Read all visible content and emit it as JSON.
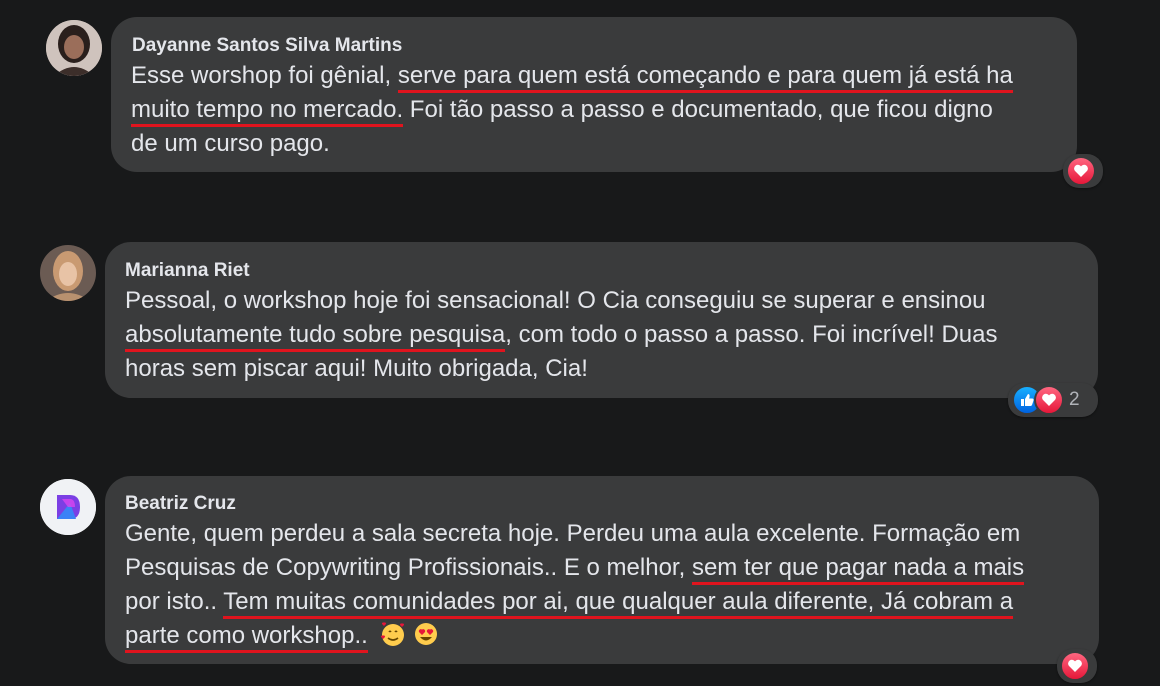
{
  "comments": [
    {
      "author": "Dayanne Santos Silva Martins",
      "avatar_icon": "profile-photo-icon",
      "lines": [
        [
          "Esse worshop foi gênial, ",
          "serve para quem está começando e para quem já está ha"
        ],
        [
          "muito tempo no mercado.",
          " Foi tão passo a passo e documentado, que ficou digno"
        ],
        [
          "de um curso pago."
        ]
      ],
      "reactions": [
        "heart-icon"
      ]
    },
    {
      "author": "Marianna Riet",
      "avatar_icon": "profile-photo-icon",
      "lines": [
        [
          "Pessoal, o workshop hoje foi sensacional! O Cia conseguiu se superar e ensinou"
        ],
        [
          "absolutamente tudo sobre pesquisa",
          ", com todo o passo a passo. Foi incrível! Duas"
        ],
        [
          "horas sem piscar aqui! Muito obrigada, Cia!"
        ]
      ],
      "reactions": [
        "like-icon",
        "heart-icon"
      ],
      "reaction_count": "2"
    },
    {
      "author": "Beatriz Cruz",
      "avatar_icon": "profile-photo-icon",
      "lines": [
        [
          "Gente, quem perdeu a sala secreta hoje. Perdeu uma aula excelente. Formação em"
        ],
        [
          "Pesquisas de Copywriting Profissionais.. E o melhor, ",
          "sem ter que pagar nada a mais"
        ],
        [
          "por isto.. ",
          "Tem muitas comunidades por ai, que qualquer aula diferente, Já cobram a"
        ],
        [
          "parte como workshop.."
        ]
      ],
      "emojis": [
        "smiling-face-with-hearts-icon",
        "heart-eyes-icon"
      ],
      "reactions": [
        "heart-icon"
      ]
    }
  ],
  "colors": {
    "background": "#18191a",
    "bubble": "#3a3b3c",
    "text": "#e4e6eb",
    "underline": "#e0141e",
    "heart": "#f33e58",
    "like": "#1877f2"
  }
}
